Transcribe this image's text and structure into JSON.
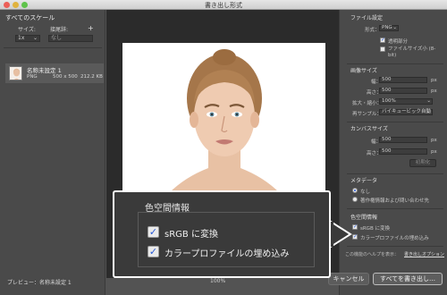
{
  "window": {
    "title": "書き出し形式"
  },
  "left": {
    "section_title": "すべてのスケール",
    "size_label": "サイズ:",
    "suffix_label": "接尾辞:",
    "add": "+",
    "scale_value": "1x",
    "suffix_value": "なし",
    "asset": {
      "name": "名称未設定 1",
      "format": "PNG",
      "dims": "500 x 500",
      "filesize": "212.2 KB"
    }
  },
  "bottom": {
    "preview_label": "プレビュー：名称未設定 1",
    "zoom": "100%",
    "cancel": "キャンセル",
    "export_all": "すべてを書き出し…"
  },
  "right": {
    "file_settings": "ファイル設定",
    "format_label": "形式：",
    "format_value": "PNG",
    "transparency": "透明部分",
    "smaller_file": "ファイルサイズ小 (8-bit)",
    "image_size": "画像サイズ",
    "width_label": "幅：",
    "width_value": "500",
    "height_label": "高さ：",
    "height_value": "500",
    "scale_label": "拡大・縮小：",
    "scale_value": "100%",
    "resample_label": "再サンプル：",
    "resample_value": "バイキュービック自動",
    "unit_px": "px",
    "canvas_size": "カンバスサイズ",
    "canvas_width_label": "幅：",
    "canvas_width_value": "500",
    "canvas_height_label": "高さ：",
    "canvas_height_value": "500",
    "reset": "初期化",
    "metadata": "メタデータ",
    "meta_none": "なし",
    "meta_copyright": "著作権情報および問い合わせ先",
    "colorspace": "色空間情報",
    "srgb": "sRGB に変換",
    "embed_profile": "カラープロファイルの埋め込み",
    "help_prefix": "この機能のヘルプを表示：",
    "help_link": "書き出しオプション"
  },
  "callout": {
    "title": "色空間情報",
    "srgb": "sRGB に変換",
    "embed_profile": "カラープロファイルの埋め込み"
  },
  "checkmark": "✓"
}
